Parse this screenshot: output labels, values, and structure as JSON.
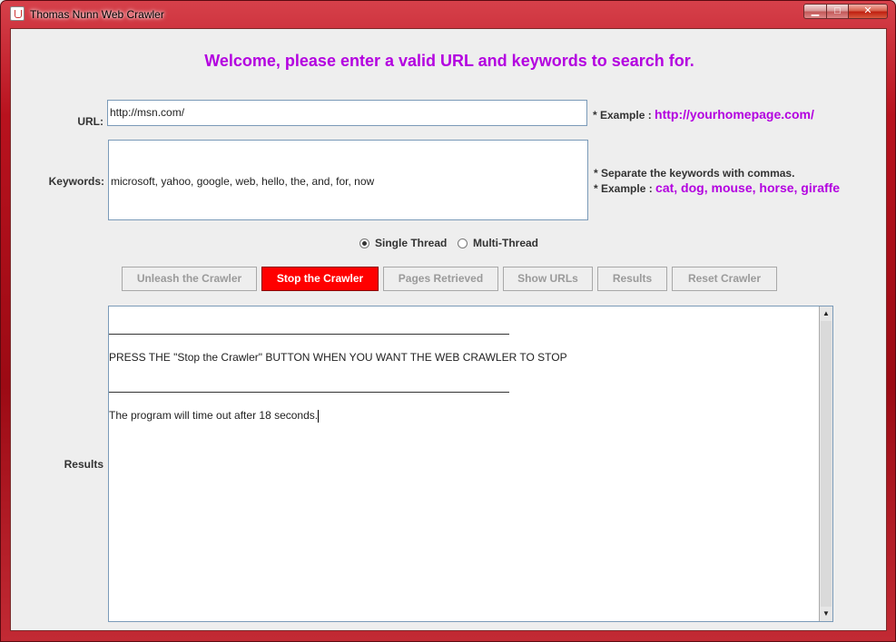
{
  "window": {
    "title": "Thomas Nunn Web Crawler",
    "controls": {
      "minimize": "▁",
      "maximize": "□",
      "close": "✕"
    }
  },
  "header": {
    "welcome": "Welcome, please enter a valid URL and keywords to search for."
  },
  "form": {
    "url_label": "URL:",
    "url_value": "http://msn.com/",
    "url_hint_prefix": "* Example :",
    "url_hint_example": "http://yourhomepage.com/",
    "keywords_label": "Keywords:",
    "keywords_value": "microsoft, yahoo, google, web, hello, the, and, for, now",
    "keywords_hint_line1": "* Separate the keywords with commas.",
    "keywords_hint_prefix": "* Example :",
    "keywords_hint_example": "cat, dog, mouse, horse, giraffe"
  },
  "threads": {
    "single_label": "Single Thread",
    "multi_label": "Multi-Thread",
    "selected": "single"
  },
  "toolbar": {
    "unleash": "Unleash the Crawler",
    "stop": "Stop the Crawler",
    "pages": "Pages Retrieved",
    "show_urls": "Show URLs",
    "results": "Results",
    "reset": "Reset Crawler"
  },
  "results": {
    "label": "Results",
    "line_press": "PRESS THE \"Stop the Crawler\" BUTTON WHEN YOU WANT THE WEB CRAWLER TO STOP",
    "line_timeout": "The program will time out after 18 seconds."
  },
  "colors": {
    "accent": "#b300e0",
    "stop_button": "#ff0000",
    "frame": "#b8121e"
  }
}
